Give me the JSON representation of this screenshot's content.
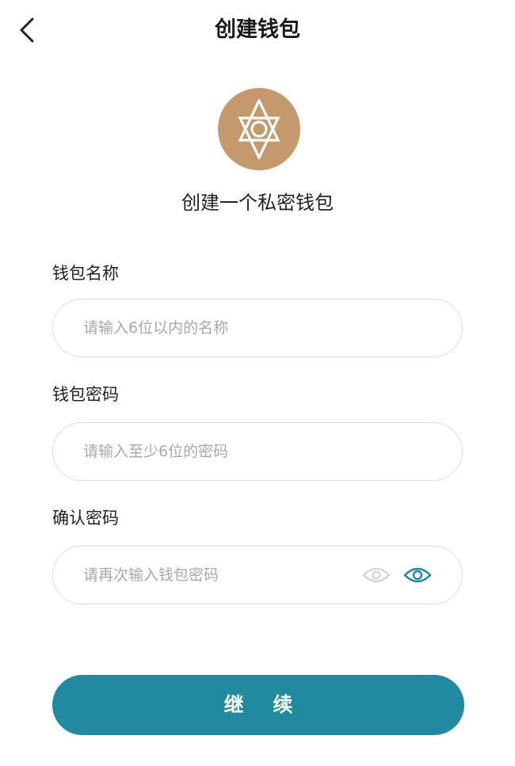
{
  "header": {
    "title": "创建钱包",
    "back_icon": "chevron-left-icon"
  },
  "logo": {
    "icon": "hexagram-icon",
    "color": "#c49a6c"
  },
  "subtitle": "创建一个私密钱包",
  "form": {
    "wallet_name": {
      "label": "钱包名称",
      "value": "",
      "placeholder": "请输入6位以内的名称"
    },
    "wallet_password": {
      "label": "钱包密码",
      "value": "",
      "placeholder": "请输入至少6位的密码"
    },
    "confirm_password": {
      "label": "确认密码",
      "value": "",
      "placeholder": "请再次输入钱包密码",
      "icons": [
        "eye-outline-icon",
        "eye-icon"
      ]
    }
  },
  "continue_label": "继 续",
  "colors": {
    "accent": "#218aa0",
    "logo_bg": "#c49a6c",
    "border": "#dcdcdc",
    "placeholder": "#a8a8a8"
  }
}
